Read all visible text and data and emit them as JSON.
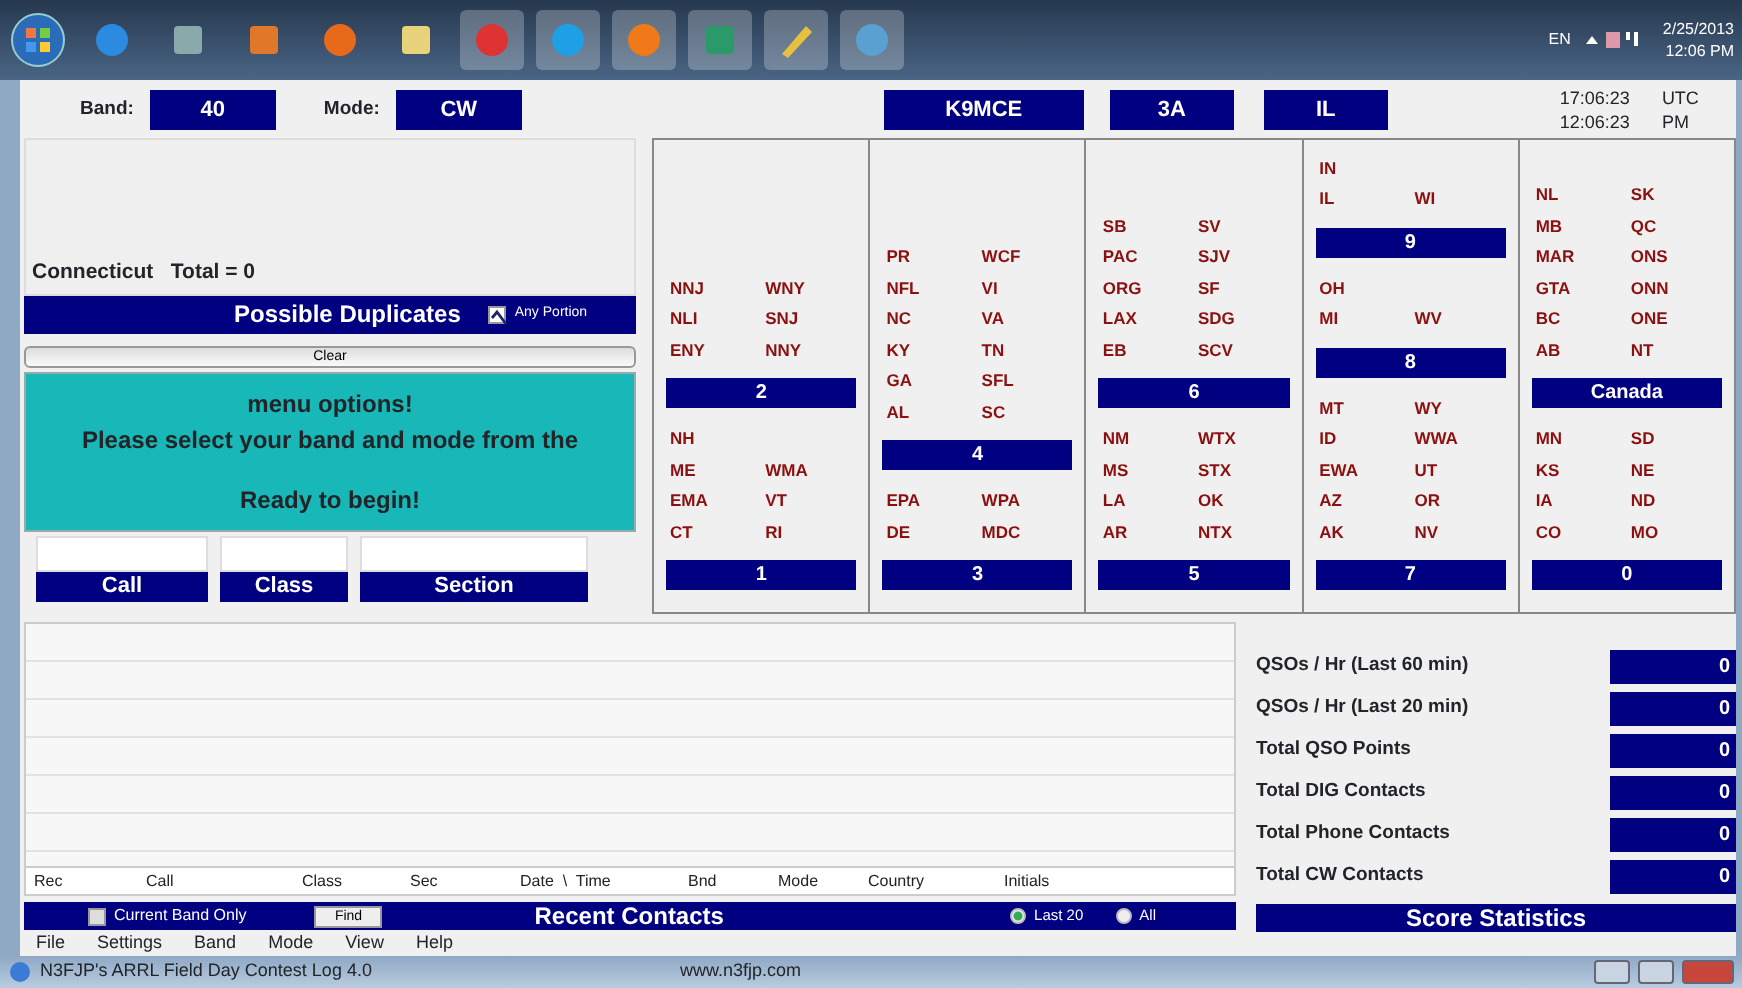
{
  "taskbar": {
    "language": "EN",
    "date": "2/25/2013",
    "time": "12:06 PM"
  },
  "status": {
    "band_label": "Band:",
    "band": "40",
    "mode_label": "Mode:",
    "mode": "CW",
    "callsign": "K9MCE",
    "class": "3A",
    "section": "IL",
    "utc_time": "17:06:23",
    "utc_suffix": "UTC",
    "local_time": "12:06:23",
    "local_suffix": "PM"
  },
  "duplicates": {
    "summary": "Connecticut   Total = 0",
    "title": "Possible Duplicates",
    "any_portion": {
      "label": "Any Portion",
      "checked": true
    }
  },
  "clear_button": "Clear",
  "message": [
    "menu options!",
    "Please select your band and mode from the",
    "Ready to begin!"
  ],
  "entry": {
    "fields": [
      {
        "label": "Call"
      },
      {
        "label": "Class"
      },
      {
        "label": "Section"
      }
    ]
  },
  "sections": [
    [
      {
        "title": "2",
        "rows": [
          [
            "NNJ",
            "WNY"
          ],
          [
            "NLI",
            "SNJ"
          ],
          [
            "ENY",
            "NNY"
          ]
        ]
      },
      {
        "title": "1",
        "rows": [
          [
            "NH"
          ],
          [
            "ME",
            "WMA"
          ],
          [
            "EMA",
            "VT"
          ],
          [
            "CT",
            "RI"
          ]
        ]
      }
    ],
    [
      {
        "title": "4",
        "rows": [
          [
            "PR",
            "WCF"
          ],
          [
            "NFL",
            "VI"
          ],
          [
            "NC",
            "VA"
          ],
          [
            "KY",
            "TN"
          ],
          [
            "GA",
            "SFL"
          ],
          [
            "AL",
            "SC"
          ]
        ]
      },
      {
        "title": "3",
        "rows": [
          [
            "EPA",
            "WPA"
          ],
          [
            "DE",
            "MDC"
          ]
        ]
      }
    ],
    [
      {
        "title": "6",
        "rows": [
          [
            "SB",
            "SV"
          ],
          [
            "PAC",
            "SJV"
          ],
          [
            "ORG",
            "SF"
          ],
          [
            "LAX",
            "SDG"
          ],
          [
            "EB",
            "SCV"
          ]
        ]
      },
      {
        "title": "5",
        "rows": [
          [
            "NM",
            "WTX"
          ],
          [
            "MS",
            "STX"
          ],
          [
            "LA",
            "OK"
          ],
          [
            "AR",
            "NTX"
          ]
        ]
      }
    ],
    [
      {
        "title": "9",
        "rows": [
          [
            "IN"
          ],
          [
            "IL",
            "WI"
          ]
        ]
      },
      {
        "title": "8",
        "rows": [
          [
            "OH"
          ],
          [
            "MI",
            "WV"
          ]
        ]
      },
      {
        "title": "7",
        "rows": [
          [
            "MT",
            "WY"
          ],
          [
            "ID",
            "WWA"
          ],
          [
            "EWA",
            "UT"
          ],
          [
            "AZ",
            "OR"
          ],
          [
            "AK",
            "NV"
          ]
        ]
      }
    ],
    [
      {
        "title": "Canada",
        "rows": [
          [
            "NL",
            "SK"
          ],
          [
            "MB",
            "QC"
          ],
          [
            "MAR",
            "ONS"
          ],
          [
            "GTA",
            "ONN"
          ],
          [
            "BC",
            "ONE"
          ],
          [
            "AB",
            "NT"
          ]
        ]
      },
      {
        "title": "0",
        "rows": [
          [
            "MN",
            "SD"
          ],
          [
            "KS",
            "NE"
          ],
          [
            "IA",
            "ND"
          ],
          [
            "CO",
            "MO"
          ]
        ]
      }
    ]
  ],
  "score_statistics": {
    "title": "Score Statistics",
    "rows": [
      {
        "label": "QSOs / Hr (Last 60 min)",
        "value": "0"
      },
      {
        "label": "QSOs / Hr (Last 20 min)",
        "value": "0"
      },
      {
        "label": "Total QSO Points",
        "value": "0"
      },
      {
        "label": "Total DIG Contacts",
        "value": "0"
      },
      {
        "label": "Total Phone Contacts",
        "value": "0"
      },
      {
        "label": "Total CW Contacts",
        "value": "0"
      }
    ]
  },
  "recent_contacts": {
    "columns": [
      "Rec",
      "Call",
      "Class",
      "Sec",
      "Date  \\  Time",
      "Bnd",
      "Mode",
      "Country",
      "Initials"
    ],
    "title": "Recent Contacts",
    "current_band_only": {
      "label": "Current Band Only",
      "checked": false
    },
    "find_button": "Find",
    "filters": [
      {
        "label": "Last 20",
        "selected": true
      },
      {
        "label": "All",
        "selected": false
      }
    ]
  },
  "menu": [
    "File",
    "Settings",
    "Band",
    "Mode",
    "View",
    "Help"
  ],
  "window": {
    "title": "N3FJP's ARRL Field Day Contest Log 4.0",
    "url": "www.n3fjp.com"
  }
}
